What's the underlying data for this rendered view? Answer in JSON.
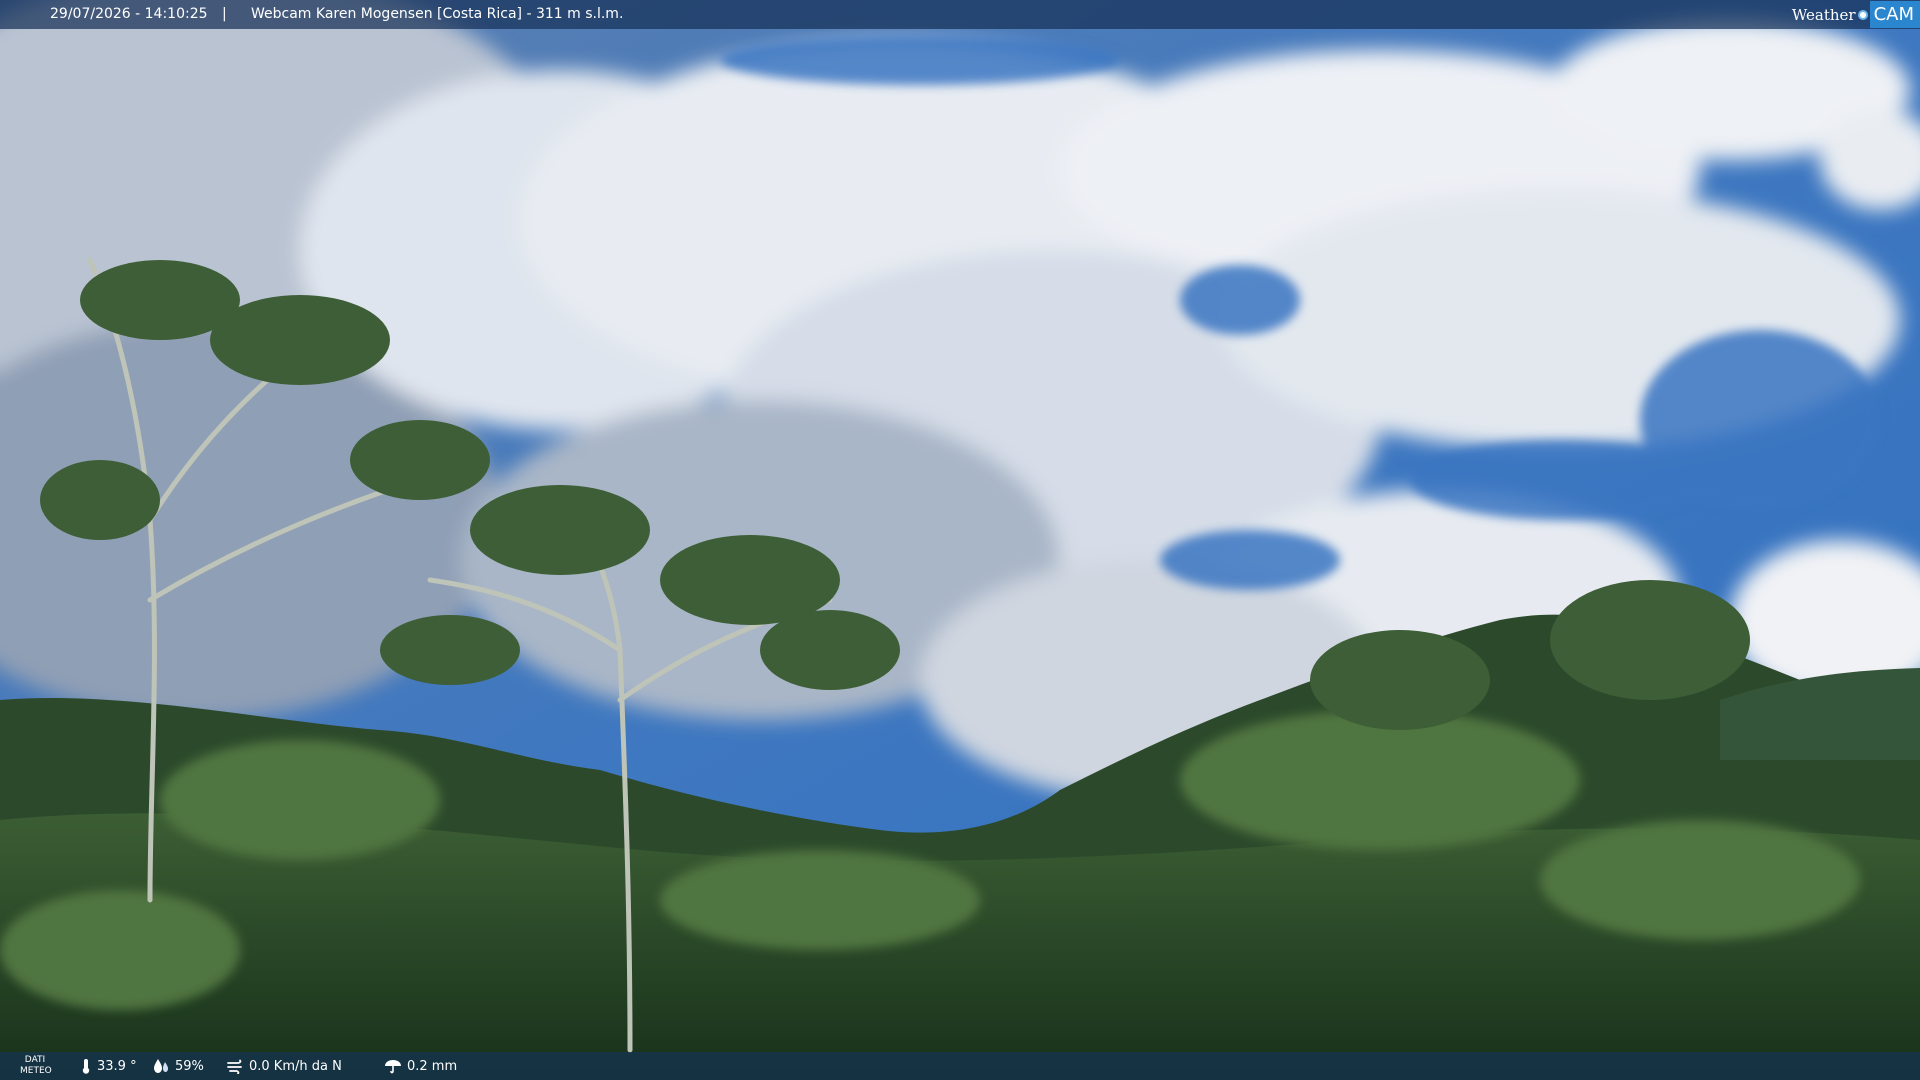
{
  "header": {
    "datetime": "29/07/2026 - 14:10:25",
    "separator": "|",
    "title": "Webcam Karen Mogensen [Costa Rica]  - 311 m s.l.m."
  },
  "logo": {
    "weather_text": "Weather",
    "cam_text": "CAM"
  },
  "weather": {
    "label_line1": "DATI",
    "label_line2": "METEO",
    "temperature": "33.9 °",
    "humidity": "59%",
    "wind": "0.0 Km/h da N",
    "rain": "0.2 mm",
    "icons": [
      "thermometer-icon",
      "humidity-drop-icon",
      "wind-icon",
      "rain-icon"
    ]
  },
  "colors": {
    "bar": "#163058",
    "logo_accent": "#2a86cf"
  }
}
